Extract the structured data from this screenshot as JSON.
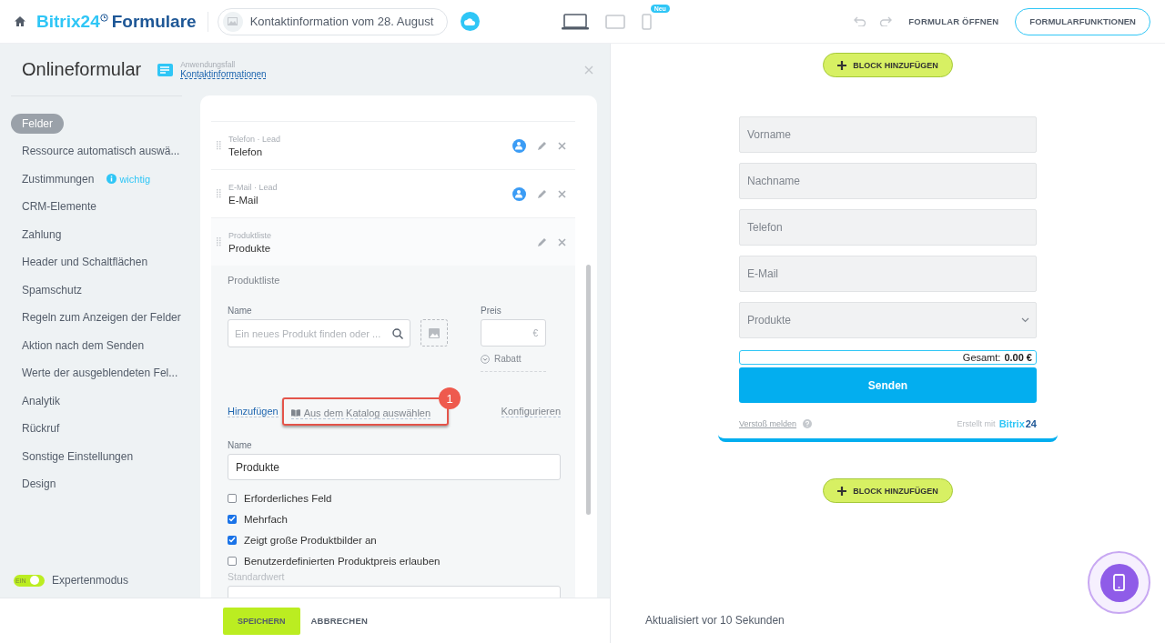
{
  "header": {
    "brand": "Bitrix24",
    "product": "Formulare",
    "form_name": "Kontaktinformation vom 28. August",
    "devices": [
      {
        "kind": "laptop",
        "selected": true
      },
      {
        "kind": "tablet",
        "selected": false
      },
      {
        "kind": "phone",
        "selected": false,
        "badge": "Neu"
      }
    ],
    "open_button": "FORMULAR ÖFFNEN",
    "functions_button": "FORMULARFUNKTIONEN"
  },
  "panel": {
    "title": "Onlineformular",
    "usecase_label": "Anwendungsfall",
    "usecase_link": "Kontaktinformationen"
  },
  "sidebar": {
    "items": [
      {
        "label": "Felder",
        "selected": true
      },
      {
        "label": "Ressource automatisch auswä...",
        "selected": false
      },
      {
        "label": "Zustimmungen",
        "selected": false,
        "hint": "wichtig"
      },
      {
        "label": "CRM-Elemente",
        "selected": false
      },
      {
        "label": "Zahlung",
        "selected": false
      },
      {
        "label": "Header und Schaltflächen",
        "selected": false
      },
      {
        "label": "Spamschutz",
        "selected": false
      },
      {
        "label": "Regeln zum Anzeigen der Felder",
        "selected": false
      },
      {
        "label": "Aktion nach dem Senden",
        "selected": false
      },
      {
        "label": "Werte der ausgeblendeten Fel...",
        "selected": false
      },
      {
        "label": "Analytik",
        "selected": false
      },
      {
        "label": "Rückruf",
        "selected": false
      },
      {
        "label": "Sonstige Einstellungen",
        "selected": false
      },
      {
        "label": "Design",
        "selected": false
      }
    ],
    "expert_toggle": {
      "label": "Expertenmodus",
      "state_text": "EIN",
      "on": true
    }
  },
  "fields": [
    {
      "subtitle": "Telefon · Lead",
      "title": "Telefon",
      "crm_linked": true,
      "expanded": false
    },
    {
      "subtitle": "E-Mail · Lead",
      "title": "E-Mail",
      "crm_linked": true,
      "expanded": false
    },
    {
      "subtitle": "Produktliste",
      "title": "Produkte",
      "crm_linked": false,
      "expanded": true
    }
  ],
  "product_editor": {
    "heading": "Produktliste",
    "name_label": "Name",
    "search_placeholder": "Ein neues Produkt finden oder ...",
    "price_label": "Preis",
    "currency": "€",
    "discount": "Rabatt",
    "add_link": "Hinzufügen",
    "catalog_link": "Aus dem Katalog auswählen",
    "configure_link": "Konfigurieren",
    "callout_number": "1",
    "field_name_label": "Name",
    "field_name_value": "Produkte",
    "options": [
      {
        "label": "Erforderliches Feld",
        "checked": false
      },
      {
        "label": "Mehrfach",
        "checked": true
      },
      {
        "label": "Zeigt große Produktbilder an",
        "checked": true
      },
      {
        "label": "Benutzerdefinierten Produktpreis erlauben",
        "checked": false
      }
    ],
    "default_label": "Standardwert"
  },
  "footer": {
    "save": "SPEICHERN",
    "cancel": "ABBRECHEN",
    "status": "Aktualisiert vor 10 Sekunden"
  },
  "preview": {
    "add_block_top": "BLOCK HINZUFÜGEN",
    "add_block_bottom": "BLOCK HINZUFÜGEN",
    "inputs": [
      {
        "kind": "text",
        "placeholder": "Vorname"
      },
      {
        "kind": "text",
        "placeholder": "Nachname"
      },
      {
        "kind": "text",
        "placeholder": "Telefon"
      },
      {
        "kind": "text",
        "placeholder": "E-Mail"
      },
      {
        "kind": "select",
        "placeholder": "Produkte"
      }
    ],
    "total_label": "Gesamt:",
    "total_value": "0.00 €",
    "submit": "Senden",
    "report": "Verstoß melden",
    "made_with": "Erstellt mit",
    "made_brand": "Bitrix",
    "made_brand_num": "24"
  }
}
